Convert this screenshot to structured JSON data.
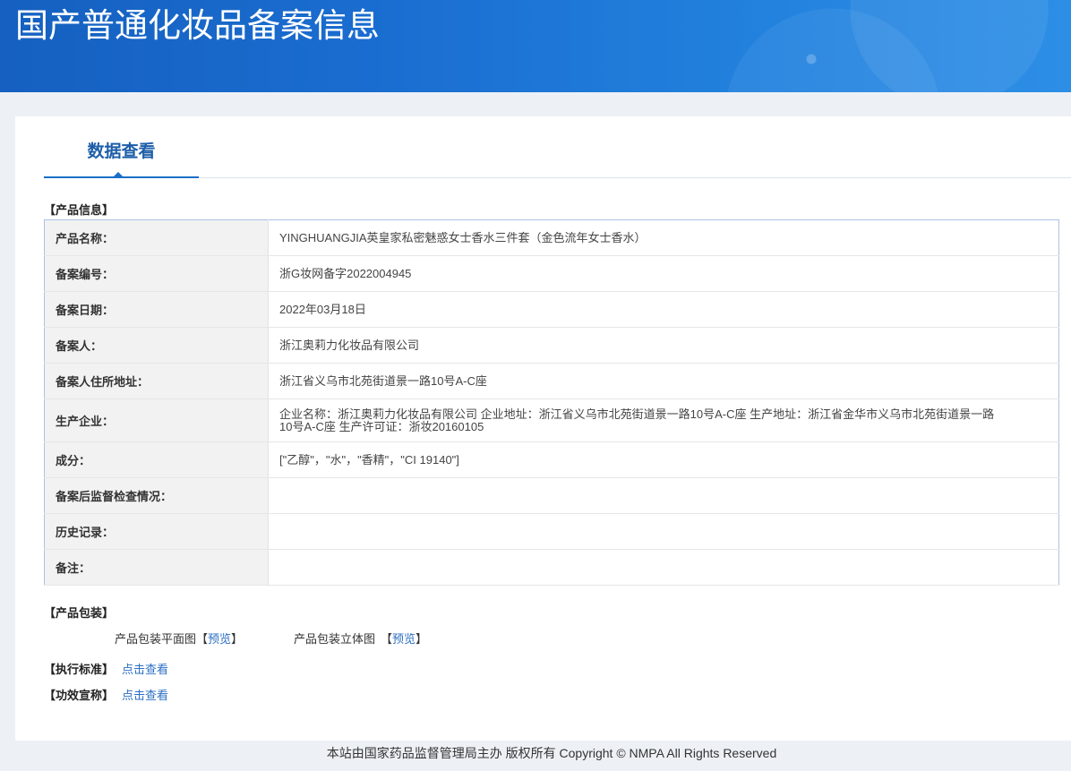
{
  "header": {
    "title": "国产普通化妆品备案信息"
  },
  "tab": {
    "label": "数据查看"
  },
  "product_info": {
    "section_title": "【产品信息】",
    "rows": [
      {
        "label": "产品名称：",
        "value": "YINGHUANGJIA英皇家私密魅惑女士香水三件套（金色流年女士香水）"
      },
      {
        "label": "备案编号：",
        "value": "浙G妆网备字2022004945"
      },
      {
        "label": "备案日期：",
        "value": "2022年03月18日"
      },
      {
        "label": "备案人：",
        "value": "浙江奥莉力化妆品有限公司"
      },
      {
        "label": "备案人住所地址：",
        "value": "浙江省义乌市北苑街道景一路10号A-C座"
      },
      {
        "label": "生产企业：",
        "value": "企业名称：浙江奥莉力化妆品有限公司 企业地址：浙江省义乌市北苑街道景一路10号A-C座 生产地址：浙江省金华市义乌市北苑街道景一路10号A-C座 生产许可证：浙妆20160105"
      },
      {
        "label": "成分：",
        "value": "[\"乙醇\"，\"水\"，\"香精\"，\"CI 19140\"]"
      },
      {
        "label": "备案后监督检查情况：",
        "value": ""
      },
      {
        "label": "历史记录：",
        "value": ""
      },
      {
        "label": "备注：",
        "value": ""
      }
    ]
  },
  "packaging": {
    "section_title": "【产品包装】",
    "flat": {
      "label": "产品包装平面图",
      "bracket_open": "【",
      "link": "预览",
      "bracket_close": "】"
    },
    "solid": {
      "label": "产品包装立体图",
      "bracket_open": "【",
      "link": "预览",
      "bracket_close": "】"
    }
  },
  "standard": {
    "section_title": "【执行标准】",
    "link": "点击查看"
  },
  "efficacy": {
    "section_title": "【功效宣称】",
    "link": "点击查看"
  },
  "footer": {
    "text": "本站由国家药品监督管理局主办 版权所有 Copyright © NMPA All Rights Reserved"
  },
  "colors": {
    "header_blue": "#1a6dd0",
    "tab_active": "#1a6fc7",
    "link": "#2b6fc4",
    "label_bg": "#f2f2f2"
  }
}
